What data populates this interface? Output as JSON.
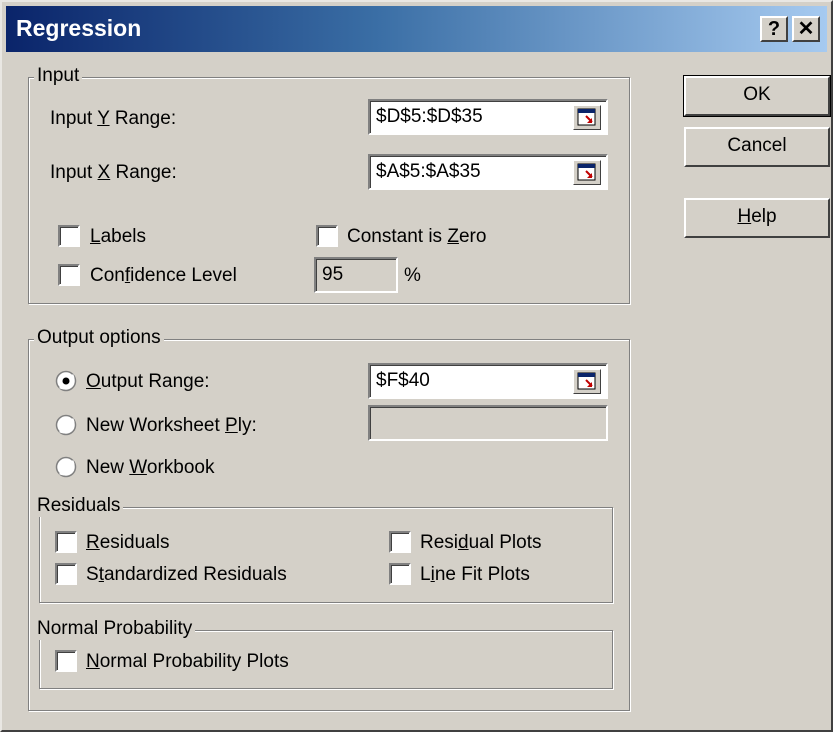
{
  "window": {
    "title": "Regression",
    "help_button": "?",
    "close_button": "✕"
  },
  "input_group": {
    "legend": "Input",
    "y_range": {
      "label": "Input Y Range:",
      "value": "$D$5:$D$35"
    },
    "x_range": {
      "label": "Input X Range:",
      "value": "$A$5:$A$35"
    },
    "labels_check": {
      "label": "Labels",
      "checked": false
    },
    "constant_zero_check": {
      "label": "Constant is Zero",
      "checked": false
    },
    "confidence_check": {
      "label": "Confidence Level",
      "checked": false
    },
    "confidence_value": "95",
    "percent_sign": "%"
  },
  "output_group": {
    "legend": "Output options",
    "output_range": {
      "label": "Output Range:",
      "value": "$F$40",
      "selected": true
    },
    "new_worksheet": {
      "label": "New Worksheet Ply:",
      "value": "",
      "selected": false
    },
    "new_workbook": {
      "label": "New Workbook",
      "selected": false
    }
  },
  "residuals_group": {
    "legend": "Residuals",
    "residuals": {
      "label": "Residuals",
      "checked": false
    },
    "standardized": {
      "label": "Standardized Residuals",
      "checked": false
    },
    "residual_plots": {
      "label": "Residual Plots",
      "checked": false
    },
    "line_fit_plots": {
      "label": "Line Fit Plots",
      "checked": false
    }
  },
  "normal_group": {
    "legend": "Normal Probability",
    "normal_plots": {
      "label": "Normal Probability Plots",
      "checked": false
    }
  },
  "buttons": {
    "ok": "OK",
    "cancel": "Cancel",
    "help": "Help"
  },
  "colors": {
    "dialog_face": "#d4d0c8",
    "title_start": "#0a246a",
    "title_end": "#a6caf0"
  }
}
